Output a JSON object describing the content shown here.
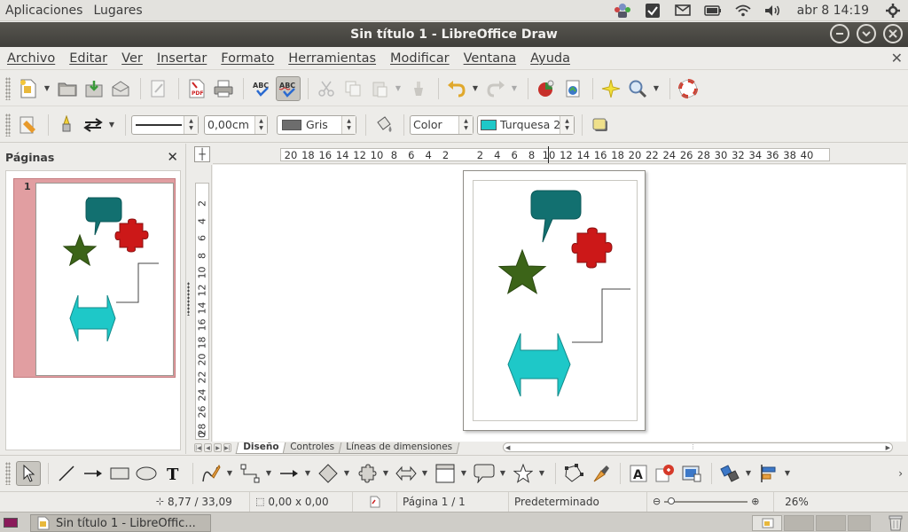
{
  "top_panel": {
    "menus": [
      "Aplicaciones",
      "Lugares"
    ],
    "clock": "abr  8 14:19",
    "indicators": [
      "people-indicator-icon",
      "check-icon",
      "mail-icon",
      "battery-icon",
      "wifi-icon",
      "volume-icon",
      "power-gear-icon"
    ]
  },
  "window": {
    "title": "Sin título 1 - LibreOffice Draw"
  },
  "menubar": [
    "Archivo",
    "Editar",
    "Ver",
    "Insertar",
    "Formato",
    "Herramientas",
    "Modificar",
    "Ventana",
    "Ayuda"
  ],
  "toolbar_format": {
    "line_width": "0,00cm",
    "line_color": "Gris",
    "line_color_hex": "#6d6d6d",
    "area_style": "Color",
    "area_color": "Turquesa 2",
    "area_color_hex": "#1ec8c8"
  },
  "pages_panel": {
    "title": "Páginas",
    "page_number": "1"
  },
  "rulers": {
    "horizontal": [
      "20",
      "18",
      "16",
      "14",
      "12",
      "10",
      "8",
      "6",
      "4",
      "2",
      "",
      "2",
      "4",
      "6",
      "8",
      "10",
      "12",
      "14",
      "16",
      "18",
      "20",
      "22",
      "24",
      "26",
      "28",
      "30",
      "32",
      "34",
      "36",
      "38",
      "40"
    ],
    "vertical": [
      "2",
      "4",
      "6",
      "8",
      "10",
      "12",
      "14",
      "16",
      "18",
      "20",
      "22",
      "24",
      "26",
      "28"
    ],
    "vertical_end": "0"
  },
  "tabs": [
    "Diseño",
    "Controles",
    "Líneas de dimensiones"
  ],
  "status_bar": {
    "position": "8,77 / 33,09",
    "size": "0,00 x 0,00",
    "page": "Página 1 / 1",
    "layout": "Predeterminado",
    "zoom": "26%",
    "zoom_level": 0.26
  },
  "taskbar": {
    "item": "Sin título 1 - LibreOffic..."
  },
  "colors": {
    "callout": "#127070",
    "star": "#3c6418",
    "puzzle": "#cc1818",
    "arrow": "#1ec8c8"
  }
}
